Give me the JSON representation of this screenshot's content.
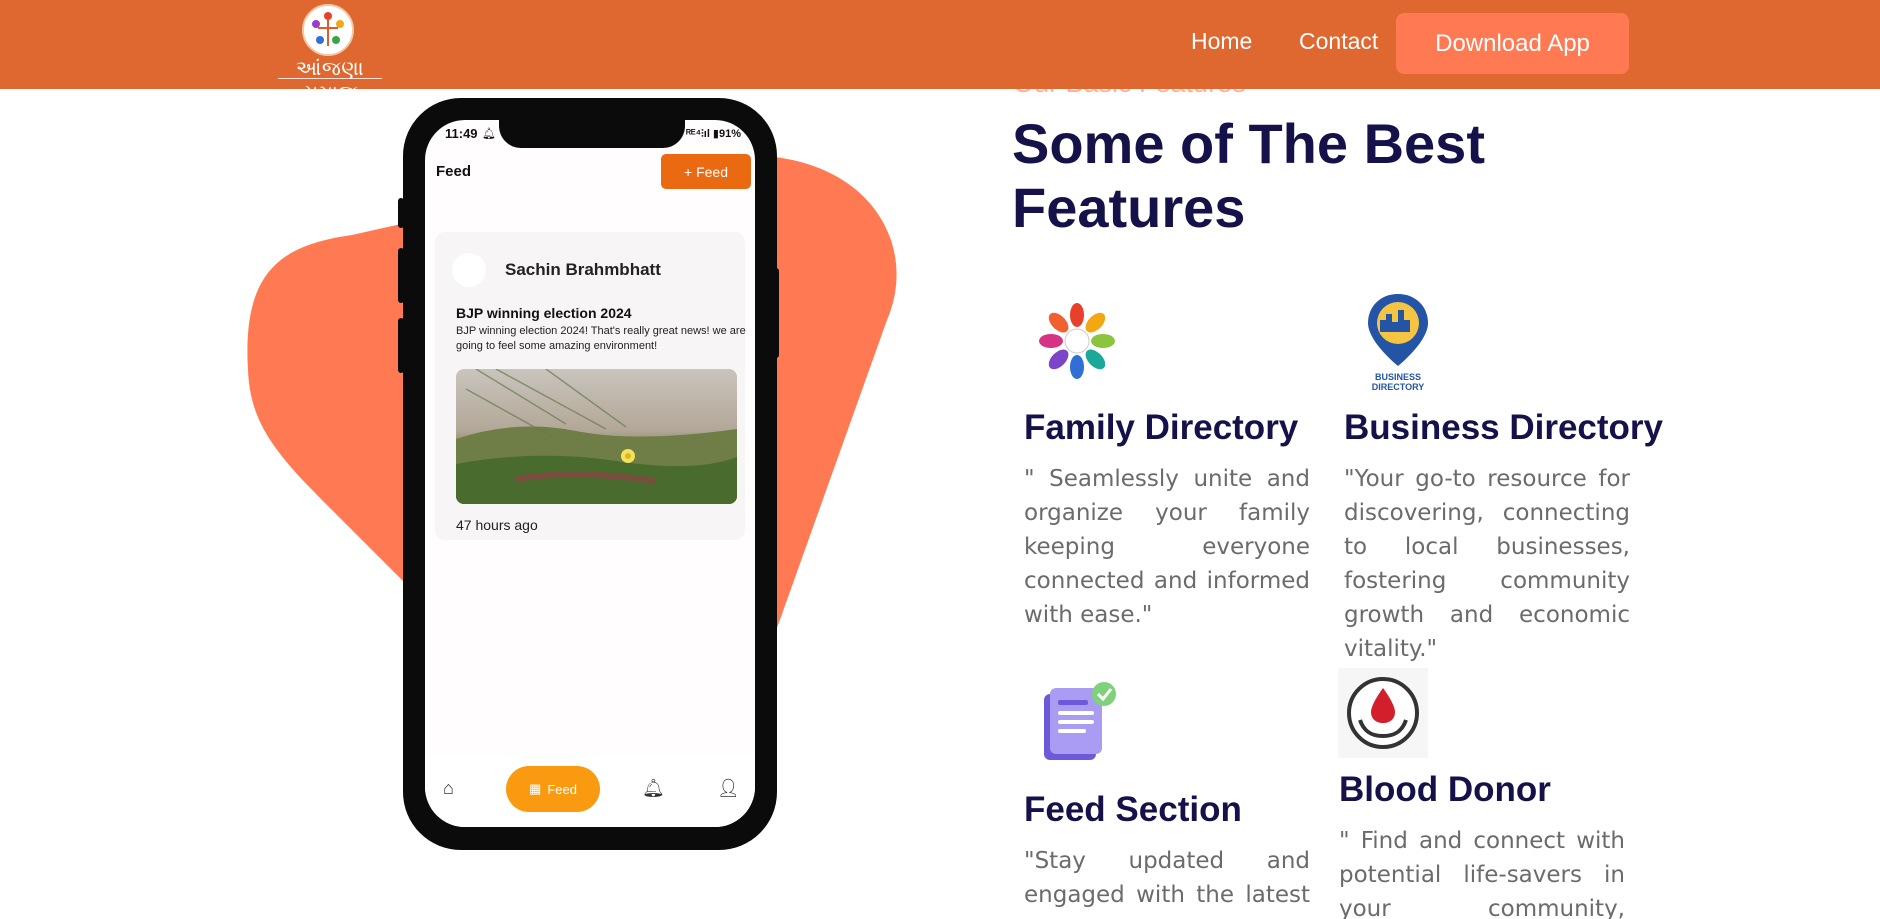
{
  "header": {
    "logo_text": "આંજણા સમાજ",
    "nav": {
      "home": "Home",
      "contact": "Contact"
    },
    "download_label": "Download App",
    "bg_color": "#de682f",
    "button_color": "#ff7a52"
  },
  "phone": {
    "status": {
      "time": "11:49",
      "right": "ᴿᴱ⁴⫶ıl ▮91%"
    },
    "feed_title": "Feed",
    "add_feed_label": "+ Feed",
    "post": {
      "author": "Sachin Brahmbhatt",
      "heading": "BJP winning election 2024",
      "body": "BJP winning election 2024! That's really great news! we are going to feel some amazing environment!",
      "time": "47 hours ago"
    },
    "bottom_nav": {
      "feed_label": "Feed"
    }
  },
  "features": {
    "subtitle": "Our Basic Features",
    "title": "Some of The Best Features",
    "items": [
      {
        "title": "Family Directory",
        "desc": "\" Seamlessly unite and organize your family keeping everyone connected and informed with ease.\"",
        "icon": "family-directory-icon"
      },
      {
        "title": "Business Directory",
        "desc": "\"Your go-to resource for discovering, connecting to local businesses, fostering community growth and economic vitality.\"",
        "icon": "business-directory-icon",
        "icon_label": "BUSINESS DIRECTORY"
      },
      {
        "title": "Feed Section",
        "desc": "\"Stay updated and engaged with the latest news,",
        "icon": "feed-section-icon"
      },
      {
        "title": "Blood Donor",
        "desc": "\" Find and connect with potential life-savers in your community, making a",
        "icon": "blood-donor-icon"
      }
    ]
  },
  "colors": {
    "title": "#15124a",
    "blob": "#ff7a52",
    "text": "#6b6b6b"
  }
}
